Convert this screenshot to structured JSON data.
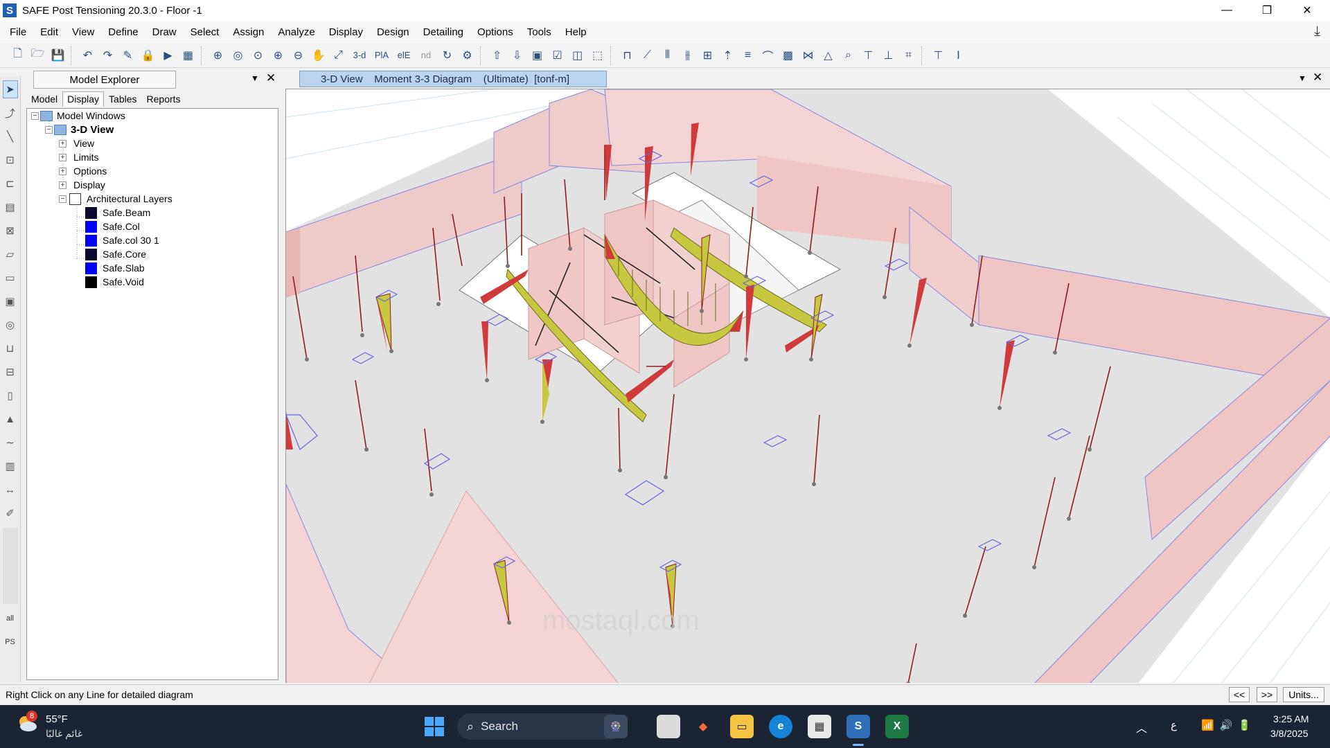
{
  "window": {
    "app_icon_letter": "S",
    "title": "SAFE Post Tensioning 20.3.0 - Floor -1",
    "minimize": "—",
    "restore": "❐",
    "close": "✕"
  },
  "menu": [
    "File",
    "Edit",
    "View",
    "Define",
    "Draw",
    "Select",
    "Assign",
    "Analyze",
    "Display",
    "Design",
    "Detailing",
    "Options",
    "Tools",
    "Help"
  ],
  "toolbar": {
    "btn_3d": "3-d",
    "btn_pla": "PlA",
    "btn_ele": "elE",
    "btn_nd": "nd"
  },
  "left_strip": {
    "all_label": "all",
    "ps_label": "PS"
  },
  "model_explorer": {
    "title": "Model Explorer",
    "tabs": [
      "Model",
      "Display",
      "Tables",
      "Reports"
    ],
    "active_tab": "Display",
    "tree": {
      "root": "Model Windows",
      "view": "3-D View",
      "children": [
        "View",
        "Limits",
        "Options",
        "Display"
      ],
      "arch_layers": "Architectural Layers",
      "layers": [
        {
          "name": "Safe.Beam",
          "color": "#0b0b2e"
        },
        {
          "name": "Safe.Col",
          "color": "#0000ff"
        },
        {
          "name": "Safe.col 30 1",
          "color": "#0000ff"
        },
        {
          "name": "Safe.Core",
          "color": "#0b0b2e"
        },
        {
          "name": "Safe.Slab",
          "color": "#0000ff"
        },
        {
          "name": "Safe.Void",
          "color": "#000000"
        }
      ]
    }
  },
  "view_panel": {
    "tab_title": "3-D View    Moment 3-3 Diagram    (Ultimate)  [tonf-m]"
  },
  "status": {
    "message": "Right Click on any Line for detailed diagram",
    "prev": "<<",
    "next": ">>",
    "units": "Units..."
  },
  "taskbar": {
    "weather_badge": "8",
    "temperature": "55°F",
    "weather_desc": "غائم غالبًا",
    "search_placeholder": "Search",
    "lang": "ع",
    "time": "3:25 AM",
    "date": "3/8/2025"
  }
}
